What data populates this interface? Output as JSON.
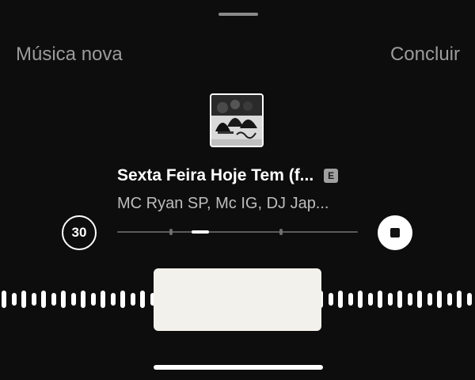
{
  "header": {
    "left_label": "Música nova",
    "right_label": "Concluir"
  },
  "track": {
    "title": "Sexta Feira Hoje Tem (f...",
    "explicit_badge": "E",
    "artist": "MC Ryan SP, Mc IG, DJ Jap...",
    "cover_art": "album-cover-image"
  },
  "controls": {
    "duration_label": "30",
    "stop_icon": "stop-icon"
  },
  "colors": {
    "background": "#0d0d0d",
    "header_text": "#9b9b9b",
    "selector": "#f3f1ec",
    "waveform": "#ffffff"
  }
}
